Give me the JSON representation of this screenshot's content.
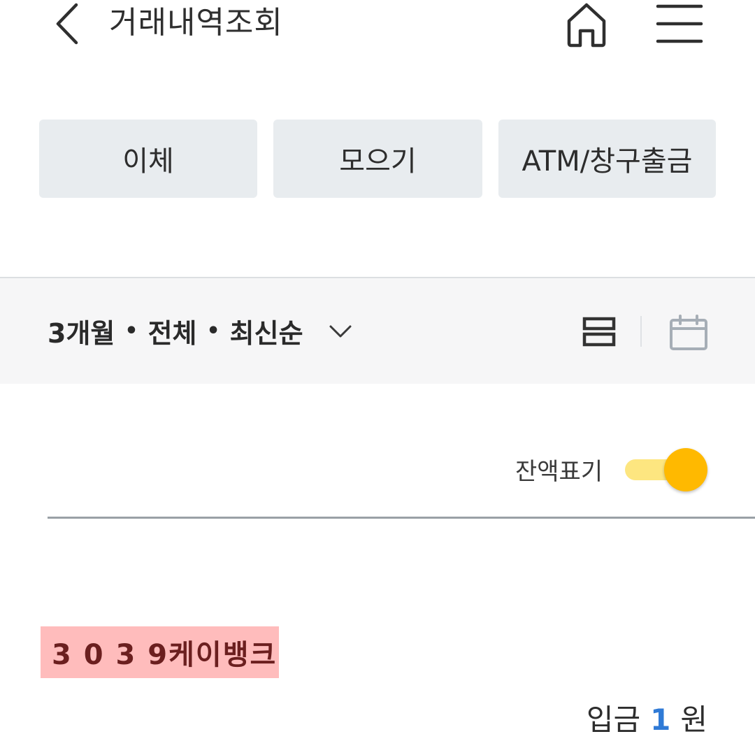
{
  "header": {
    "title": "거래내역조회",
    "back_icon": "chevron-left-icon",
    "home_icon": "home-icon",
    "menu_icon": "hamburger-menu-icon"
  },
  "filter_buttons": [
    {
      "label": "이체"
    },
    {
      "label": "모으기"
    },
    {
      "label": "ATM/창구출금"
    }
  ],
  "options": {
    "period": "3개월",
    "separator": "•",
    "type": "전체",
    "sort": "최신순",
    "dropdown_icon": "chevron-down-icon",
    "list_view_icon": "list-view-icon",
    "calendar_icon": "calendar-icon"
  },
  "balance_toggle": {
    "label": "잔액표기",
    "on": true,
    "colors": {
      "track": "#fde680",
      "knob": "#ffb900"
    }
  },
  "transactions": [
    {
      "name": "3 0 3 9케이뱅크",
      "type_label": "입금",
      "amount": "1",
      "unit": "원"
    }
  ],
  "colors": {
    "accent_blue": "#2f7ad6",
    "highlight_red": "#ffbcbc",
    "button_bg": "#e8ecef"
  }
}
